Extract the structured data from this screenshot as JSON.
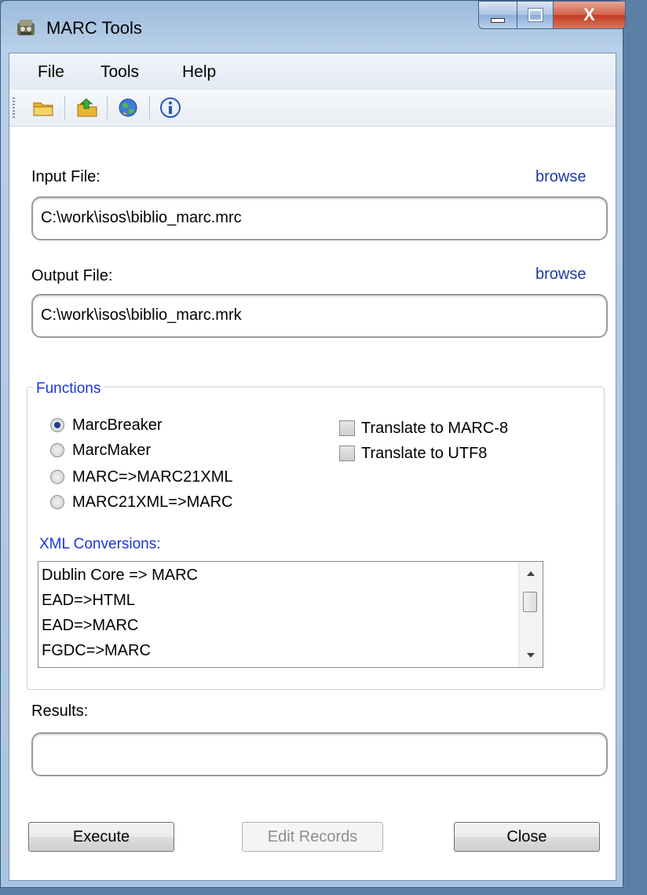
{
  "window": {
    "title": "MARC Tools",
    "close_glyph": "X"
  },
  "menu": [
    "File",
    "Tools",
    "Help"
  ],
  "toolbar": {
    "icons": [
      "folder-open-icon",
      "export-icon",
      "globe-icon",
      "info-icon"
    ]
  },
  "input": {
    "label": "Input File:",
    "browse": "browse",
    "value": "C:\\work\\isos\\biblio_marc.mrc"
  },
  "output": {
    "label": "Output File:",
    "browse": "browse",
    "value": "C:\\work\\isos\\biblio_marc.mrk"
  },
  "functions": {
    "title": "Functions",
    "radios": [
      {
        "label": "MarcBreaker",
        "checked": true
      },
      {
        "label": "MarcMaker",
        "checked": false
      },
      {
        "label": "MARC=>MARC21XML",
        "checked": false
      },
      {
        "label": "MARC21XML=>MARC",
        "checked": false
      }
    ],
    "checkboxes": [
      {
        "label": "Translate to MARC-8",
        "checked": false
      },
      {
        "label": "Translate to UTF8",
        "checked": false
      }
    ],
    "xml_label": "XML Conversions:",
    "xml_list": [
      "Dublin Core => MARC",
      "EAD=>HTML",
      "EAD=>MARC",
      "FGDC=>MARC"
    ]
  },
  "results": {
    "label": "Results:",
    "value": ""
  },
  "buttons": {
    "execute": "Execute",
    "edit": "Edit Records",
    "close": "Close"
  },
  "colors": {
    "link": "#1c3aa8",
    "group_title": "#1a35d6"
  }
}
